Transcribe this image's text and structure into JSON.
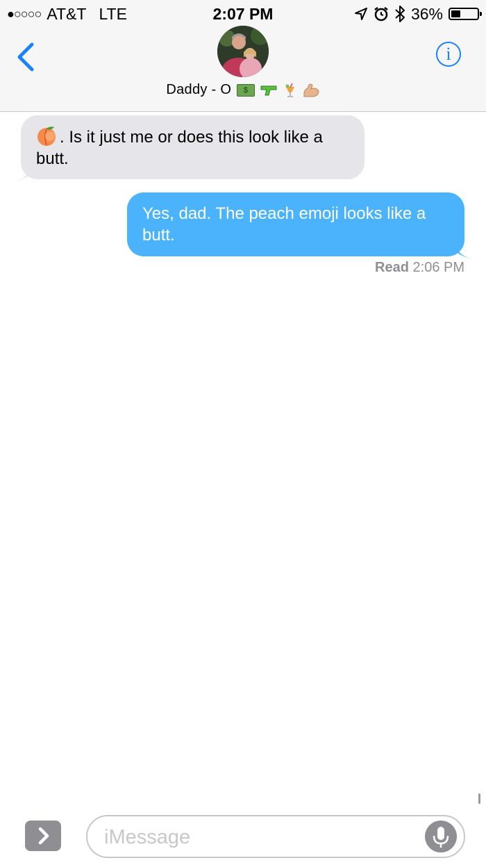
{
  "status_bar": {
    "signal_dots": "●○○○○",
    "carrier": "AT&T",
    "network": "LTE",
    "time": "2:07 PM",
    "battery_percent": "36%",
    "battery_level": 0.36
  },
  "header": {
    "contact_name": "Daddy - O",
    "name_emojis": [
      "money-bill-icon",
      "water-gun-icon",
      "tropical-drink-icon",
      "flexed-biceps-icon"
    ],
    "back_icon": "chevron-left-icon",
    "info_icon": "info-icon",
    "info_glyph": "i",
    "accent_color": "#1a82fb"
  },
  "messages": [
    {
      "direction": "incoming",
      "emoji": "peach-icon",
      "text": ". Is it just me or does this look like a butt.",
      "bubble_color": "#e5e5ea"
    },
    {
      "direction": "outgoing",
      "text": "Yes, dad. The peach emoji looks like a butt.",
      "bubble_color": "#4ab3fc"
    }
  ],
  "read_receipt": {
    "label": "Read",
    "time": "2:06 PM"
  },
  "composer": {
    "placeholder": "iMessage",
    "value": "",
    "apps_icon": "chevron-right-icon",
    "mic_icon": "microphone-icon"
  }
}
